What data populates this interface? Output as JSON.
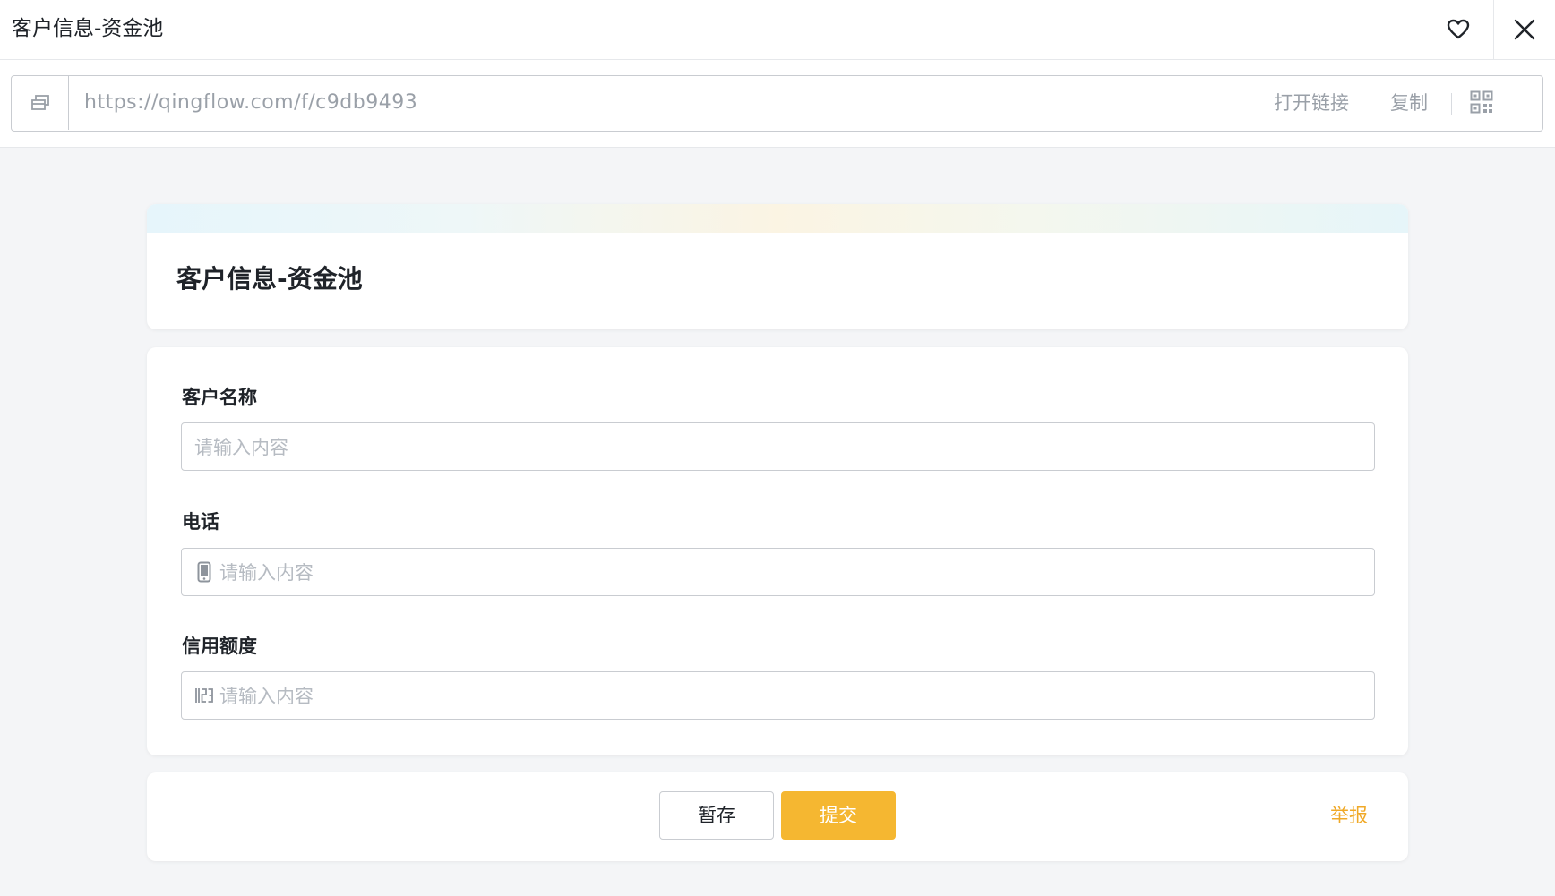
{
  "titlebar": {
    "title": "客户信息-资金池",
    "favorite_icon": "heart-icon",
    "close_icon": "close-icon"
  },
  "urlbar": {
    "link_icon": "window-link-icon",
    "url": "https://qingflow.com/f/c9db9493",
    "open_link_label": "打开链接",
    "copy_label": "复制",
    "qr_icon": "qr-code-icon"
  },
  "form": {
    "title": "客户信息-资金池",
    "fields": [
      {
        "label": "客户名称",
        "placeholder": "请输入内容",
        "icon": ""
      },
      {
        "label": "电话",
        "placeholder": "请输入内容",
        "icon": "phone-icon"
      },
      {
        "label": "信用额度",
        "placeholder": "请输入内容",
        "icon": "number-icon"
      }
    ]
  },
  "actions": {
    "save_label": "暂存",
    "submit_label": "提交",
    "report_label": "举报"
  },
  "colors": {
    "accent": "#f5b731",
    "report": "#f0a928",
    "background": "#f4f5f7"
  }
}
